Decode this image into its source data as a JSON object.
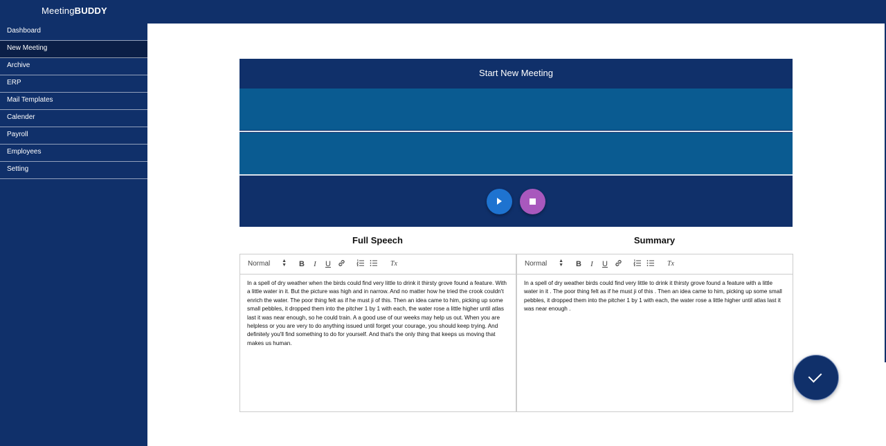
{
  "app": {
    "brand_prefix": "Meeting",
    "brand_suffix": "BUDDY"
  },
  "sidebar": {
    "items": [
      {
        "label": "Dashboard",
        "active": false
      },
      {
        "label": "New Meeting",
        "active": true
      },
      {
        "label": "Archive",
        "active": false
      },
      {
        "label": "ERP",
        "active": false
      },
      {
        "label": "Mail Templates",
        "active": false
      },
      {
        "label": "Calender",
        "active": false
      },
      {
        "label": "Payroll",
        "active": false
      },
      {
        "label": "Employees",
        "active": false
      },
      {
        "label": "Setting",
        "active": false
      }
    ]
  },
  "recorder": {
    "title": "Start New Meeting",
    "play_icon": "play-icon",
    "stop_icon": "stop-icon"
  },
  "full_speech": {
    "heading": "Full Speech",
    "format": "Normal",
    "text": "In a spell of dry weather when the birds could find very little to drink it thirsty grove found a feature. With a little water in it. But the picture was high and in narrow. And no matter how he tried the crook couldn't enrich the water. The poor thing felt as if he must ji of this. Then an idea came to him, picking up some small pebbles, it dropped them into the pitcher 1 by 1 with each, the water rose a little higher until atlas last it was near enough, so he could train. A a good use of our weeks may help us out. When you are helpless or you are very to do anything issued until forget your courage, you should keep trying. And definitely you'll find something to do for yourself. And that's the only thing that keeps us moving that makes us human."
  },
  "summary": {
    "heading": "Summary",
    "format": "Normal",
    "text": "In a spell of dry weather birds could find very little to drink it thirsty grove found a feature with a little water in it . The poor thing felt as if he must ji of this . Then an idea came to him, picking up some small pebbles, it dropped them into the pitcher 1 by 1 with each, the water rose a little higher until atlas last it was near enough ."
  },
  "toolbar": {
    "bold": "B",
    "italic": "I",
    "underline": "U",
    "clear": "Tx"
  },
  "colors": {
    "navy": "#10306a",
    "band": "#0a5b91",
    "play": "#1e73d0",
    "stop": "#a858bd"
  }
}
